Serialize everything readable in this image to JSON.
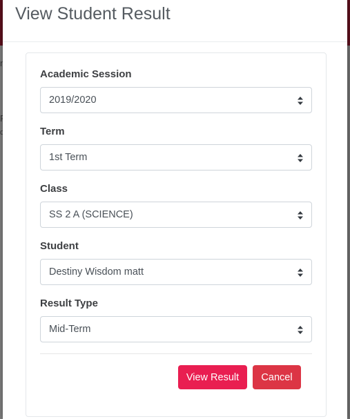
{
  "background": {
    "glyph_a": "n",
    "glyph_b": "F",
    "glyph_c": "d"
  },
  "modal": {
    "title": "View Student Result"
  },
  "form": {
    "fields": [
      {
        "label": "Academic Session",
        "value": "2019/2020"
      },
      {
        "label": "Term",
        "value": "1st Term"
      },
      {
        "label": "Class",
        "value": "SS 2 A (SCIENCE)"
      },
      {
        "label": "Student",
        "value": "Destiny Wisdom matt"
      },
      {
        "label": "Result Type",
        "value": "Mid-Term"
      }
    ]
  },
  "actions": {
    "view_label": "View Result",
    "cancel_label": "Cancel"
  },
  "colors": {
    "primary": "#e91e51",
    "danger": "#dc3545",
    "header_bar": "#5a0f1c"
  }
}
